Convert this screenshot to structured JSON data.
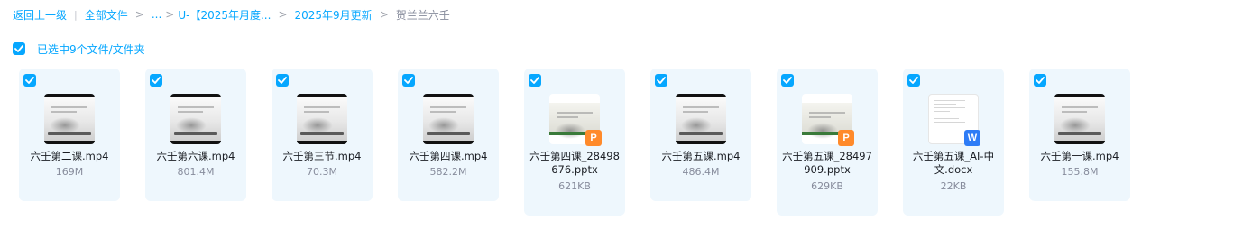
{
  "breadcrumb": {
    "back": "返回上一级",
    "all_files": "全部文件",
    "ellipsis": "...",
    "folder_truncated": "U-【2025年月度...",
    "folder_month": "2025年9月更新",
    "current": "贺兰兰六壬"
  },
  "selection": {
    "label": "已选中9个文件/文件夹"
  },
  "colors": {
    "accent": "#06a7ff",
    "card_bg": "#eef7fd",
    "ppt_badge": "#ff8a2b",
    "doc_badge": "#2e7cf6"
  },
  "files": [
    {
      "name": "六壬第二课.mp4",
      "size": "169M",
      "kind": "video"
    },
    {
      "name": "六壬第六课.mp4",
      "size": "801.4M",
      "kind": "video"
    },
    {
      "name": "六壬第三节.mp4",
      "size": "70.3M",
      "kind": "video"
    },
    {
      "name": "六壬第四课.mp4",
      "size": "582.2M",
      "kind": "video"
    },
    {
      "name": "六壬第四课_28498676.pptx",
      "size": "621KB",
      "kind": "pptx",
      "badge": "P"
    },
    {
      "name": "六壬第五课.mp4",
      "size": "486.4M",
      "kind": "video"
    },
    {
      "name": "六壬第五课_28497909.pptx",
      "size": "629KB",
      "kind": "pptx",
      "badge": "P"
    },
    {
      "name": "六壬第五课_AI-中文.docx",
      "size": "22KB",
      "kind": "docx",
      "badge": "W"
    },
    {
      "name": "六壬第一课.mp4",
      "size": "155.8M",
      "kind": "video"
    }
  ]
}
